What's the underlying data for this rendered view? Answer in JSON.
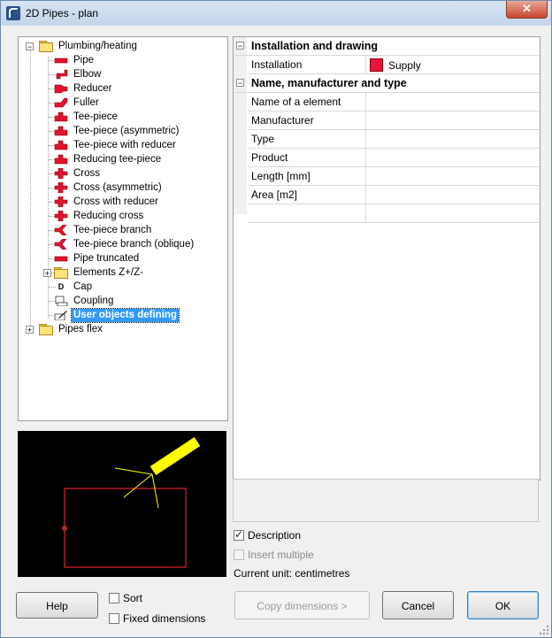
{
  "window": {
    "title": "2D Pipes - plan",
    "close_glyph": "✕"
  },
  "tree": {
    "root": "Plumbing/heating",
    "items": [
      {
        "label": "Pipe",
        "icon": "pipe-icon"
      },
      {
        "label": "Elbow",
        "icon": "elbow-icon"
      },
      {
        "label": "Reducer",
        "icon": "reducer-icon"
      },
      {
        "label": "Fuller",
        "icon": "fuller-icon"
      },
      {
        "label": "Tee-piece",
        "icon": "tee-piece-icon"
      },
      {
        "label": "Tee-piece (asymmetric)",
        "icon": "tee-piece-icon"
      },
      {
        "label": "Tee-piece with reducer",
        "icon": "tee-piece-icon"
      },
      {
        "label": "Reducing tee-piece",
        "icon": "tee-piece-icon"
      },
      {
        "label": "Cross",
        "icon": "cross-icon"
      },
      {
        "label": "Cross (asymmetric)",
        "icon": "cross-icon"
      },
      {
        "label": "Cross with reducer",
        "icon": "cross-icon"
      },
      {
        "label": "Reducing cross",
        "icon": "cross-icon"
      },
      {
        "label": "Tee-piece branch",
        "icon": "branch-icon"
      },
      {
        "label": "Tee-piece branch (oblique)",
        "icon": "branch-icon"
      },
      {
        "label": "Pipe truncated",
        "icon": "pipe-icon"
      },
      {
        "label": "Elements Z+/Z-",
        "icon": "folder-icon"
      },
      {
        "label": "Cap",
        "icon": "cap-icon"
      },
      {
        "label": "Coupling",
        "icon": "coupling-icon"
      },
      {
        "label": "User objects defining",
        "icon": "user-object-icon"
      }
    ],
    "second_root": "Pipes flex",
    "cap_glyph": "D"
  },
  "properties": {
    "cat1": "Installation and drawing",
    "installation_key": "Installation",
    "installation_value": "Supply",
    "supply_color": "#e8143c",
    "cat2": "Name, manufacturer and type",
    "rows": [
      "Name of a element",
      "Manufacturer",
      "Type",
      "Product",
      "Length [mm]",
      "Area [m2]"
    ]
  },
  "options": {
    "description": "Description",
    "description_checked": true,
    "insert_multiple": "Insert multiple",
    "insert_multiple_checked": false,
    "current_unit": "Current unit: centimetres"
  },
  "footer": {
    "help": "Help",
    "sort": "Sort",
    "fixed_dimensions": "Fixed dimensions",
    "copy_dimensions": "Copy dimensions  >",
    "cancel": "Cancel",
    "ok": "OK"
  }
}
